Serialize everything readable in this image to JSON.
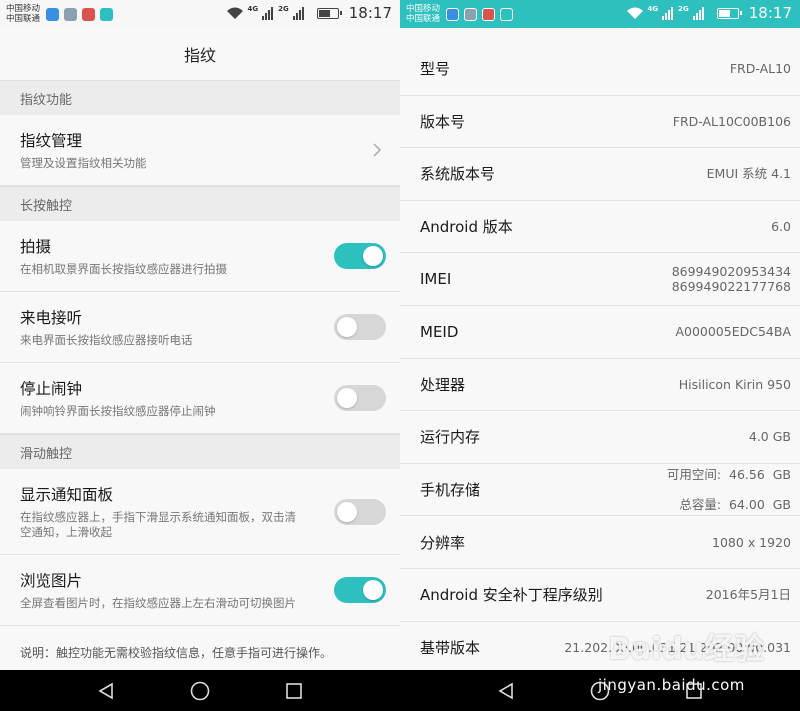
{
  "status_bar": {
    "carrier1": "中国移动",
    "carrier2": "中国联通",
    "net1": "4G",
    "net2": "2G",
    "time": "18:17",
    "battery_level": 0.6
  },
  "fingerprint_screen": {
    "title": "指纹",
    "sections": [
      {
        "header": "指纹功能"
      },
      {
        "header": "长按触控"
      },
      {
        "header": "滑动触控"
      }
    ],
    "manage": {
      "title": "指纹管理",
      "subtitle": "管理及设置指纹相关功能"
    },
    "settings": [
      {
        "title": "拍摄",
        "subtitle": "在相机取景界面长按指纹感应器进行拍摄",
        "enabled": true
      },
      {
        "title": "来电接听",
        "subtitle": "来电界面长按指纹感应器接听电话",
        "enabled": false
      },
      {
        "title": "停止闹钟",
        "subtitle": "闹钟响铃界面长按指纹感应器停止闹钟",
        "enabled": false
      },
      {
        "title": "显示通知面板",
        "subtitle": "在指纹感应器上，手指下滑显示系统通知面板，双击清空通知，上滑收起",
        "enabled": false
      },
      {
        "title": "浏览图片",
        "subtitle": "全屏查看图片时，在指纹感应器上左右滑动可切换图片",
        "enabled": true
      }
    ],
    "note": "说明：触控功能无需校验指纹信息，任意手指可进行操作。"
  },
  "about_screen": {
    "rows": [
      {
        "label": "型号",
        "value": "FRD-AL10"
      },
      {
        "label": "版本号",
        "value": "FRD-AL10C00B106"
      },
      {
        "label": "系统版本号",
        "value": "EMUI 系统 4.1"
      },
      {
        "label": "Android 版本",
        "value": "6.0"
      },
      {
        "label": "IMEI",
        "value": "869949020953434",
        "value2": "869949022177768"
      },
      {
        "label": "MEID",
        "value": "A000005EDC54BA"
      },
      {
        "label": "处理器",
        "value": "Hisilicon Kirin 950"
      },
      {
        "label": "运行内存",
        "value": "4.0 GB"
      },
      {
        "label": "手机存储",
        "value": "可用空间:  46.56  GB",
        "value2": "总容量:  64.00  GB"
      },
      {
        "label": "分辨率",
        "value": "1080 x 1920"
      },
      {
        "label": "Android 安全补丁程序级别",
        "value": "2016年5月1日"
      },
      {
        "label": "基带版本",
        "value": "21.202.00.00.031,21.202.00.00.031"
      }
    ]
  },
  "watermark": {
    "logo": "Baidu经验",
    "url": "jingyan.baidu.com"
  },
  "colors": {
    "accent": "#2ebfbf",
    "toggle_off": "#d7d7d7",
    "section_bg": "#ececec"
  }
}
